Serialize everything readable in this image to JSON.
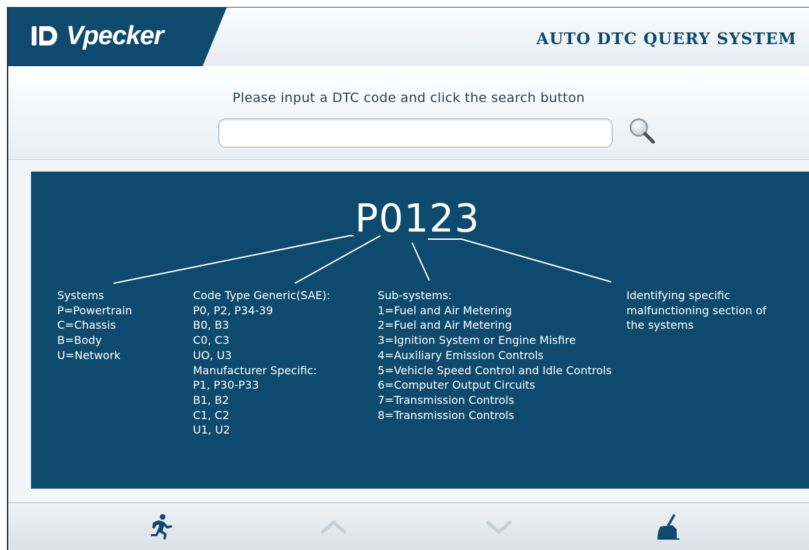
{
  "header": {
    "brand": "Vpecker",
    "logo_icon": "vpecker-logo-icon",
    "title": "AUTO DTC QUERY SYSTEM"
  },
  "search": {
    "prompt": "Please input a DTC code and click the search button",
    "value": "",
    "placeholder": "",
    "button_icon": "magnifier-search-icon"
  },
  "diagram": {
    "code": "P0123",
    "systems": [
      "Systems",
      "P=Powertrain",
      "C=Chassis",
      "B=Body",
      "U=Network"
    ],
    "code_type": [
      "Code Type Generic(SAE):",
      "P0, P2, P34-39",
      "B0, B3",
      "C0, C3",
      "UO, U3",
      "Manufacturer Specific:",
      "P1, P30-P33",
      "B1, B2",
      "C1, C2",
      "U1, U2"
    ],
    "sub_systems": [
      "Sub-systems:",
      "1=Fuel and Air Metering",
      "2=Fuel and Air Metering",
      "3=Ignition System or Engine Misfire",
      "4=Auxiliary Emission Controls",
      "5=Vehicle Speed Control and Idle Controls",
      "6=Computer Output Circuits",
      "7=Transmission Controls",
      "8=Transmission Controls"
    ],
    "identifying": [
      "Identifying specific",
      "malfunctioning section of",
      "the systems"
    ]
  },
  "footer": {
    "buttons": [
      {
        "icon": "running-man-exit-icon",
        "enabled": true
      },
      {
        "icon": "chevron-up-icon",
        "enabled": false
      },
      {
        "icon": "chevron-down-icon",
        "enabled": false
      },
      {
        "icon": "broom-clear-icon",
        "enabled": true
      }
    ]
  },
  "colors": {
    "brand_blue": "#0d4a6e",
    "title_blue": "#0d4a6e",
    "disabled_arrow": "#c6d0d7"
  }
}
